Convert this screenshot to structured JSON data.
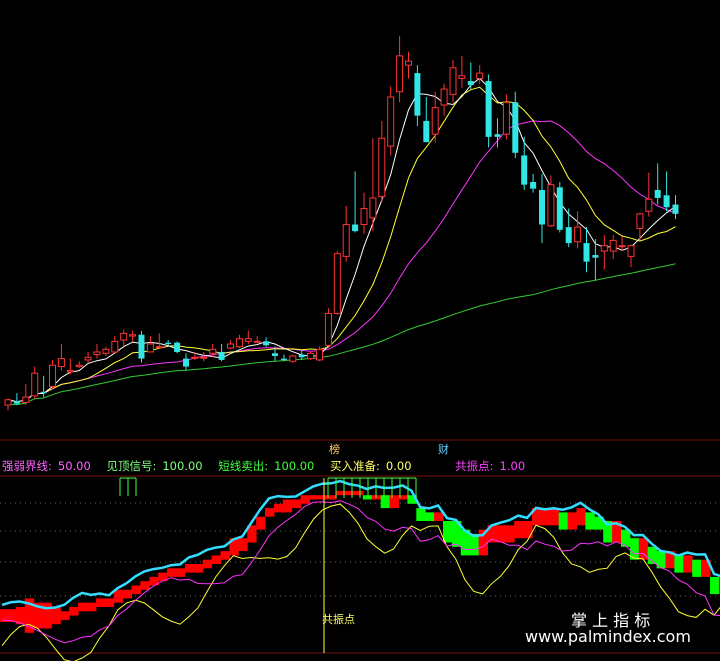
{
  "markers": {
    "bang": "榜",
    "cai": "财"
  },
  "legend": [
    {
      "label": "强弱界线:",
      "value": "50.00",
      "color": "#ff66ff"
    },
    {
      "label": "见顶信号:",
      "value": "100.00",
      "color": "#80ff80"
    },
    {
      "label": "短线卖出:",
      "value": "100.00",
      "color": "#40ff40"
    },
    {
      "label": "买入准备:",
      "value": "0.00",
      "color": "#ffff66"
    },
    {
      "label": "共振点:",
      "value": "1.00",
      "color": "#ff40ff"
    }
  ],
  "resonance_label": "共振点",
  "watermark": {
    "cn": "掌 上 指 标",
    "url": "www.palmindex.com"
  },
  "colors": {
    "up": "#ff3333",
    "down": "#33e6e6",
    "ma5": "#ffffff",
    "ma10": "#ffff33",
    "ma20": "#ff33ff",
    "ma60": "#33cc33",
    "bar_red": "#ff0000",
    "bar_green": "#00ff00",
    "cyan_line": "#33ddff",
    "yellow_line": "#ffff33",
    "magenta_line": "#ff33ff"
  },
  "chart_data": {
    "type": "candlestick",
    "title": "",
    "candles": [
      {
        "o": 3.0,
        "h": 3.5,
        "l": 2.6,
        "c": 3.4
      },
      {
        "o": 3.3,
        "h": 3.9,
        "l": 3.0,
        "c": 3.1
      },
      {
        "o": 3.2,
        "h": 4.6,
        "l": 3.0,
        "c": 3.6
      },
      {
        "o": 3.7,
        "h": 5.9,
        "l": 3.5,
        "c": 5.4
      },
      {
        "o": 4.0,
        "h": 5.2,
        "l": 3.6,
        "c": 3.9
      },
      {
        "o": 4.4,
        "h": 6.4,
        "l": 4.2,
        "c": 6.0
      },
      {
        "o": 5.9,
        "h": 7.6,
        "l": 5.6,
        "c": 6.5
      },
      {
        "o": 5.5,
        "h": 6.5,
        "l": 5.3,
        "c": 5.6
      },
      {
        "o": 5.9,
        "h": 6.3,
        "l": 5.8,
        "c": 6.0
      },
      {
        "o": 6.4,
        "h": 7.0,
        "l": 6.2,
        "c": 6.6
      },
      {
        "o": 6.8,
        "h": 7.6,
        "l": 6.5,
        "c": 7.0
      },
      {
        "o": 6.9,
        "h": 7.4,
        "l": 6.7,
        "c": 7.2
      },
      {
        "o": 7.0,
        "h": 8.2,
        "l": 6.9,
        "c": 7.8
      },
      {
        "o": 7.9,
        "h": 8.7,
        "l": 7.4,
        "c": 8.4
      },
      {
        "o": 8.2,
        "h": 8.6,
        "l": 7.8,
        "c": 8.3
      },
      {
        "o": 8.3,
        "h": 8.6,
        "l": 6.2,
        "c": 6.5
      },
      {
        "o": 7.0,
        "h": 8.2,
        "l": 7.0,
        "c": 7.6
      },
      {
        "o": 7.4,
        "h": 8.4,
        "l": 7.3,
        "c": 7.4
      },
      {
        "o": 7.7,
        "h": 7.9,
        "l": 7.5,
        "c": 7.6
      },
      {
        "o": 7.7,
        "h": 7.8,
        "l": 6.9,
        "c": 7.0
      },
      {
        "o": 6.5,
        "h": 6.9,
        "l": 5.6,
        "c": 5.9
      },
      {
        "o": 6.6,
        "h": 7.0,
        "l": 6.4,
        "c": 6.6
      },
      {
        "o": 6.6,
        "h": 7.0,
        "l": 6.3,
        "c": 6.6
      },
      {
        "o": 6.9,
        "h": 7.6,
        "l": 6.6,
        "c": 7.2
      },
      {
        "o": 7.0,
        "h": 7.6,
        "l": 6.3,
        "c": 6.4
      },
      {
        "o": 7.3,
        "h": 7.9,
        "l": 7.2,
        "c": 7.6
      },
      {
        "o": 7.4,
        "h": 8.3,
        "l": 7.3,
        "c": 8.0
      },
      {
        "o": 7.8,
        "h": 8.6,
        "l": 7.6,
        "c": 8.0
      },
      {
        "o": 7.8,
        "h": 8.2,
        "l": 7.7,
        "c": 7.8
      },
      {
        "o": 7.8,
        "h": 8.1,
        "l": 7.4,
        "c": 7.5
      },
      {
        "o": 6.9,
        "h": 7.4,
        "l": 6.3,
        "c": 6.7
      },
      {
        "o": 6.5,
        "h": 6.8,
        "l": 6.3,
        "c": 6.4
      },
      {
        "o": 6.3,
        "h": 6.8,
        "l": 6.2,
        "c": 6.7
      },
      {
        "o": 6.8,
        "h": 7.2,
        "l": 6.4,
        "c": 6.6
      },
      {
        "o": 6.5,
        "h": 7.0,
        "l": 6.4,
        "c": 6.9
      },
      {
        "o": 6.4,
        "h": 7.4,
        "l": 6.3,
        "c": 7.2
      },
      {
        "o": 7.5,
        "h": 10.3,
        "l": 7.4,
        "c": 9.9
      },
      {
        "o": 9.9,
        "h": 14.6,
        "l": 9.8,
        "c": 14.4
      },
      {
        "o": 14.2,
        "h": 18.0,
        "l": 13.8,
        "c": 16.6
      },
      {
        "o": 16.6,
        "h": 20.6,
        "l": 16.0,
        "c": 16.1
      },
      {
        "o": 16.6,
        "h": 19.0,
        "l": 15.9,
        "c": 17.8
      },
      {
        "o": 17.1,
        "h": 23.1,
        "l": 16.1,
        "c": 18.6
      },
      {
        "o": 18.7,
        "h": 24.4,
        "l": 18.3,
        "c": 23.1
      },
      {
        "o": 22.5,
        "h": 27.0,
        "l": 21.8,
        "c": 26.2
      },
      {
        "o": 26.6,
        "h": 30.8,
        "l": 25.8,
        "c": 29.3
      },
      {
        "o": 28.6,
        "h": 29.6,
        "l": 27.6,
        "c": 28.9
      },
      {
        "o": 28.0,
        "h": 28.6,
        "l": 24.0,
        "c": 24.8
      },
      {
        "o": 24.4,
        "h": 26.2,
        "l": 22.8,
        "c": 22.8
      },
      {
        "o": 23.4,
        "h": 26.6,
        "l": 22.8,
        "c": 25.4
      },
      {
        "o": 25.6,
        "h": 27.2,
        "l": 24.8,
        "c": 26.8
      },
      {
        "o": 26.4,
        "h": 29.0,
        "l": 25.8,
        "c": 28.4
      },
      {
        "o": 27.6,
        "h": 29.3,
        "l": 26.9,
        "c": 27.8
      },
      {
        "o": 27.4,
        "h": 28.8,
        "l": 26.8,
        "c": 27.1
      },
      {
        "o": 27.6,
        "h": 28.6,
        "l": 27.2,
        "c": 28.0
      },
      {
        "o": 27.4,
        "h": 27.9,
        "l": 22.4,
        "c": 23.2
      },
      {
        "o": 23.4,
        "h": 24.6,
        "l": 22.4,
        "c": 23.2
      },
      {
        "o": 23.4,
        "h": 26.4,
        "l": 23.0,
        "c": 25.8
      },
      {
        "o": 25.8,
        "h": 26.6,
        "l": 21.6,
        "c": 22.0
      },
      {
        "o": 21.8,
        "h": 23.2,
        "l": 19.2,
        "c": 19.6
      },
      {
        "o": 19.8,
        "h": 20.4,
        "l": 19.0,
        "c": 19.3
      },
      {
        "o": 19.2,
        "h": 20.4,
        "l": 15.2,
        "c": 16.6
      },
      {
        "o": 16.5,
        "h": 20.3,
        "l": 16.4,
        "c": 19.6
      },
      {
        "o": 19.4,
        "h": 19.8,
        "l": 16.0,
        "c": 16.2
      },
      {
        "o": 16.4,
        "h": 17.8,
        "l": 14.9,
        "c": 15.2
      },
      {
        "o": 15.3,
        "h": 17.6,
        "l": 14.8,
        "c": 16.4
      },
      {
        "o": 15.2,
        "h": 16.4,
        "l": 13.0,
        "c": 13.8
      },
      {
        "o": 14.3,
        "h": 15.5,
        "l": 12.4,
        "c": 14.1
      },
      {
        "o": 14.6,
        "h": 15.8,
        "l": 13.2,
        "c": 15.0
      },
      {
        "o": 14.6,
        "h": 15.8,
        "l": 14.0,
        "c": 15.4
      },
      {
        "o": 15.0,
        "h": 15.7,
        "l": 14.6,
        "c": 15.0
      },
      {
        "o": 14.2,
        "h": 15.1,
        "l": 13.4,
        "c": 15.0
      },
      {
        "o": 16.3,
        "h": 17.5,
        "l": 15.4,
        "c": 17.4
      },
      {
        "o": 17.6,
        "h": 20.5,
        "l": 17.2,
        "c": 18.5
      },
      {
        "o": 19.2,
        "h": 21.2,
        "l": 18.1,
        "c": 18.6
      },
      {
        "o": 18.8,
        "h": 20.6,
        "l": 17.6,
        "c": 17.9
      },
      {
        "o": 18.1,
        "h": 18.8,
        "l": 17.0,
        "c": 17.4
      }
    ],
    "indicator": {
      "hist": [
        [
          -1.5,
          1.5
        ],
        [
          -1.5,
          1.5
        ],
        [
          -2.0,
          2.0
        ],
        [
          -4.0,
          4.0
        ],
        [
          -3.0,
          3.0
        ],
        [
          -3.0,
          3.0
        ],
        [
          -2.0,
          2.0
        ],
        [
          -1.0,
          1.0
        ],
        [
          0.0,
          2.0
        ],
        [
          1.0,
          3.0
        ],
        [
          1.0,
          3.0
        ],
        [
          2.0,
          4.0
        ],
        [
          2.0,
          4.0
        ],
        [
          3.0,
          6.0
        ],
        [
          4.0,
          6.0
        ],
        [
          5.0,
          7.0
        ],
        [
          6.0,
          8.0
        ],
        [
          7.0,
          9.0
        ],
        [
          8.0,
          10.0
        ],
        [
          9.0,
          11.0
        ],
        [
          9.0,
          11.0
        ],
        [
          10.0,
          12.0
        ],
        [
          10.0,
          12.0
        ],
        [
          11.0,
          13.0
        ],
        [
          12.0,
          14.0
        ],
        [
          13.0,
          15.0
        ],
        [
          14.0,
          18.0
        ],
        [
          15.0,
          18.0
        ],
        [
          17.0,
          21.0
        ],
        [
          20.0,
          23.0
        ],
        [
          23.0,
          25.0
        ],
        [
          24.0,
          26.0
        ],
        [
          24.0,
          27.0
        ],
        [
          25.0,
          27.0
        ],
        [
          26.0,
          28.0
        ],
        [
          27.0,
          28.0
        ],
        [
          27.0,
          28.0
        ],
        [
          27.0,
          28.0
        ],
        [
          28.0,
          29.0
        ],
        [
          28.0,
          29.0
        ],
        [
          28.0,
          29.0
        ],
        [
          27.0,
          28.0
        ],
        [
          27.0,
          28.0
        ],
        [
          25.0,
          28.0
        ],
        [
          25.0,
          28.0
        ],
        [
          27.0,
          28.0
        ],
        [
          26.0,
          28.0
        ],
        [
          22.0,
          25.0
        ],
        [
          22.0,
          24.0
        ],
        [
          22.0,
          24.0
        ],
        [
          17.0,
          22.0
        ],
        [
          16.0,
          22.0
        ],
        [
          14.0,
          20.0
        ],
        [
          14.0,
          19.0
        ],
        [
          14.0,
          20.0
        ],
        [
          17.0,
          21.0
        ],
        [
          17.0,
          21.0
        ],
        [
          17.0,
          21.0
        ],
        [
          18.0,
          22.0
        ],
        [
          18.0,
          22.0
        ],
        [
          21.0,
          25.0
        ],
        [
          21.0,
          25.0
        ],
        [
          21.0,
          25.0
        ],
        [
          20.0,
          24.0
        ],
        [
          20.0,
          24.0
        ],
        [
          21.0,
          25.0
        ],
        [
          20.0,
          24.0
        ],
        [
          20.0,
          23.0
        ],
        [
          17.0,
          22.0
        ],
        [
          17.0,
          22.0
        ],
        [
          16.0,
          20.0
        ],
        [
          13.0,
          18.0
        ],
        [
          13.0,
          18.0
        ],
        [
          12.0,
          16.0
        ],
        [
          11.0,
          15.0
        ],
        [
          11.0,
          15.0
        ],
        [
          10.0,
          14.0
        ],
        [
          10.0,
          14.0
        ],
        [
          9.0,
          13.0
        ],
        [
          9.0,
          13.0
        ],
        [
          5.0,
          9.0
        ],
        [
          5.0,
          9.0
        ],
        [
          3.0,
          7.0
        ],
        [
          2.0,
          6.0
        ]
      ]
    }
  }
}
